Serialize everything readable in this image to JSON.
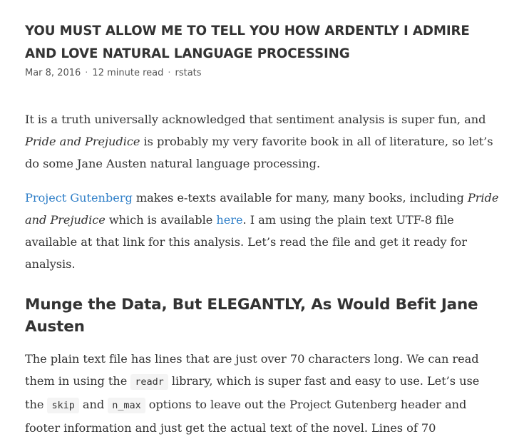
{
  "post": {
    "title": "YOU MUST ALLOW ME TO TELL YOU HOW ARDENTLY I ADMIRE AND LOVE NATURAL LANGUAGE PROCESSING",
    "date": "Mar 8, 2016",
    "separator": "·",
    "read_time": "12 minute read",
    "tag": "rstats"
  },
  "content": {
    "p1": {
      "t1": "It is a truth universally acknowledged that sentiment analysis is super fun, and ",
      "em1": "Pride and Prejudice",
      "t2": " is probably my very favorite book in all of literature, so let’s do some Jane Austen natural language processing."
    },
    "p2": {
      "link1": "Project Gutenberg",
      "t1": " makes e-texts available for many, many books, including ",
      "em1": "Pride and Prejudice",
      "t2": " which is available ",
      "link2": "here",
      "t3": ". I am using the plain text UTF-8 file available at that link for this analysis. Let’s read the file and get it ready for analysis."
    },
    "heading": "Munge the Data, But ELEGANTLY, As Would Befit Jane Austen",
    "p3": {
      "t1": "The plain text file has lines that are just over 70 characters long. We can read them in using the ",
      "code1": "readr",
      "t2": " library, which is super fast and easy to use. Let’s use the ",
      "code2": "skip",
      "t3": " and ",
      "code3": "n_max",
      "t4": " options to leave out the Project Gutenberg header and footer information and just get the actual text of the novel. Lines of 70"
    }
  },
  "colors": {
    "link": "#2f7fc8",
    "text": "#333333",
    "code_bg": "#f4f4f4"
  }
}
